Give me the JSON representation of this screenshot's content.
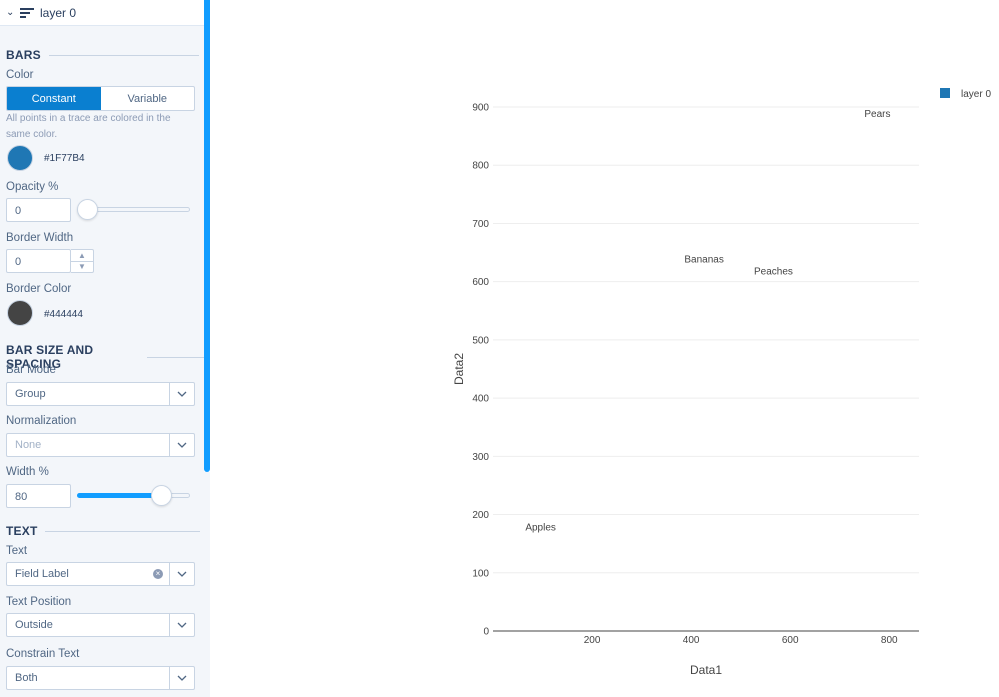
{
  "layer": {
    "name": "layer 0"
  },
  "sections": {
    "bars": "BARS",
    "bar_size": "BAR SIZE AND SPACING",
    "text": "TEXT"
  },
  "color": {
    "label": "Color",
    "options": [
      "Constant",
      "Variable"
    ],
    "selected": "Constant",
    "help": "All points in a trace are colored in the same color.",
    "value": "#1F77B4"
  },
  "opacity": {
    "label": "Opacity %",
    "value": "0",
    "level": 0
  },
  "border_width": {
    "label": "Border Width",
    "value": "0"
  },
  "border_color": {
    "label": "Border Color",
    "value": "#444444"
  },
  "bar_mode": {
    "label": "Bar Mode",
    "value": "Group"
  },
  "normalization": {
    "label": "Normalization",
    "value": "None"
  },
  "width": {
    "label": "Width %",
    "value": "80",
    "level": 80
  },
  "text_field": {
    "label": "Text",
    "value": "Field Label"
  },
  "text_position": {
    "label": "Text Position",
    "value": "Outside"
  },
  "constrain_text": {
    "label": "Constrain Text",
    "value": "Both"
  },
  "colors": {
    "accent": "#119dff",
    "selected_segment": "#0a7fd0",
    "panel_bg": "#f3f6fa",
    "trace": "#1F77B4",
    "border": "#444444"
  },
  "chart_data": {
    "type": "bar",
    "xlabel": "Data1",
    "ylabel": "Data2",
    "xlim": [
      0,
      860
    ],
    "ylim": [
      0,
      900
    ],
    "xticks": [
      200,
      400,
      600,
      800
    ],
    "yticks": [
      0,
      100,
      200,
      300,
      400,
      500,
      600,
      700,
      800,
      900
    ],
    "grid": true,
    "legend_position": "top-right",
    "series": [
      {
        "name": "layer 0",
        "color": "#1F77B4",
        "points": [
          {
            "label": "Apples",
            "x": 80,
            "y": 200
          },
          {
            "label": "Bananas",
            "x": 410,
            "y": 660
          },
          {
            "label": "Peaches",
            "x": 550,
            "y": 640
          },
          {
            "label": "Pears",
            "x": 760,
            "y": 910
          }
        ]
      }
    ]
  }
}
